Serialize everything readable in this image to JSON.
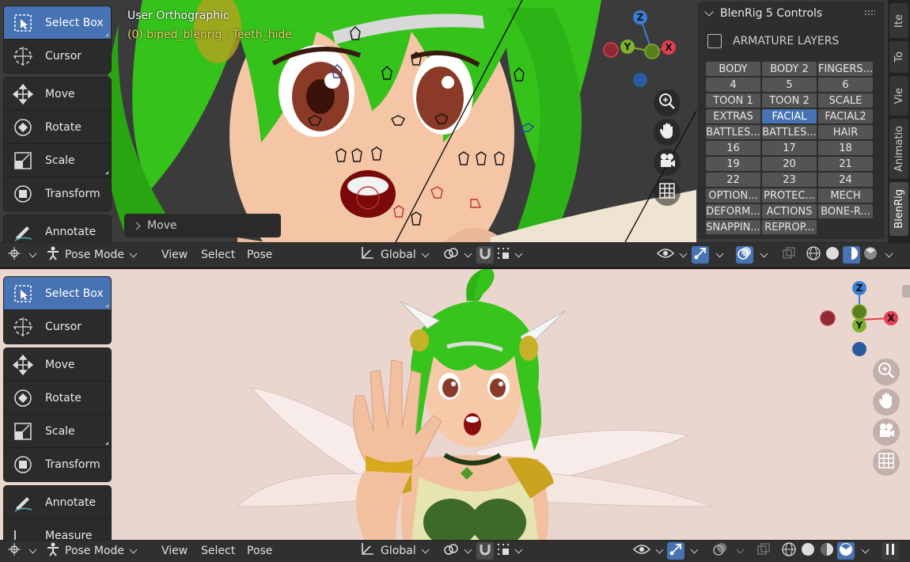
{
  "top_viewport": {
    "title": "User Orthographic",
    "subtitle": "(0) biped_blenrig : Teeth_hide",
    "last_operator": "Move"
  },
  "tools_top": [
    {
      "label": "Select Box",
      "icon": "select-box-icon",
      "active": true
    },
    {
      "label": "Cursor",
      "icon": "cursor-icon"
    },
    {
      "label": "Move",
      "icon": "move-icon"
    },
    {
      "label": "Rotate",
      "icon": "rotate-icon"
    },
    {
      "label": "Scale",
      "icon": "scale-icon"
    },
    {
      "label": "Transform",
      "icon": "transform-icon"
    },
    {
      "label": "Annotate",
      "icon": "annotate-icon"
    }
  ],
  "tools_bottom": [
    {
      "label": "Select Box",
      "icon": "select-box-icon",
      "active": true
    },
    {
      "label": "Cursor",
      "icon": "cursor-icon"
    },
    {
      "label": "Move",
      "icon": "move-icon"
    },
    {
      "label": "Rotate",
      "icon": "rotate-icon"
    },
    {
      "label": "Scale",
      "icon": "scale-icon"
    },
    {
      "label": "Transform",
      "icon": "transform-icon"
    },
    {
      "label": "Annotate",
      "icon": "annotate-icon"
    },
    {
      "label": "Measure",
      "icon": "measure-icon"
    }
  ],
  "header": {
    "mode": "Pose Mode",
    "menus": [
      "View",
      "Select",
      "Pose"
    ],
    "orientation": "Global"
  },
  "gizmo": {
    "x": "X",
    "y": "Y",
    "z": "Z"
  },
  "npanel": {
    "title": "BlenRig 5 Controls",
    "section": "ARMATURE LAYERS",
    "layers": [
      "BODY",
      "BODY 2",
      "FINGERS...",
      "4",
      "5",
      "6",
      "TOON 1",
      "TOON 2",
      "SCALE",
      "EXTRAS",
      "FACIAL",
      "FACIAL2",
      "BATTLES...",
      "BATTLES...",
      "HAIR",
      "16",
      "17",
      "18",
      "19",
      "20",
      "21",
      "22",
      "23",
      "24",
      "OPTION...",
      "PROTEC...",
      "MECH",
      "DEFORM...",
      "ACTIONS",
      "BONE-R...",
      "SNAPPIN...",
      "REPROP..."
    ],
    "active_layer": "FACIAL"
  },
  "side_tabs": [
    "Ite",
    "To",
    "Vie",
    "Animatio",
    "BlenRig"
  ],
  "active_side_tab": "BlenRig",
  "colors": {
    "accent": "#4772b3",
    "x_axis": "#e0404f",
    "y_axis": "#7fb22a",
    "z_axis": "#3a7fd6"
  }
}
